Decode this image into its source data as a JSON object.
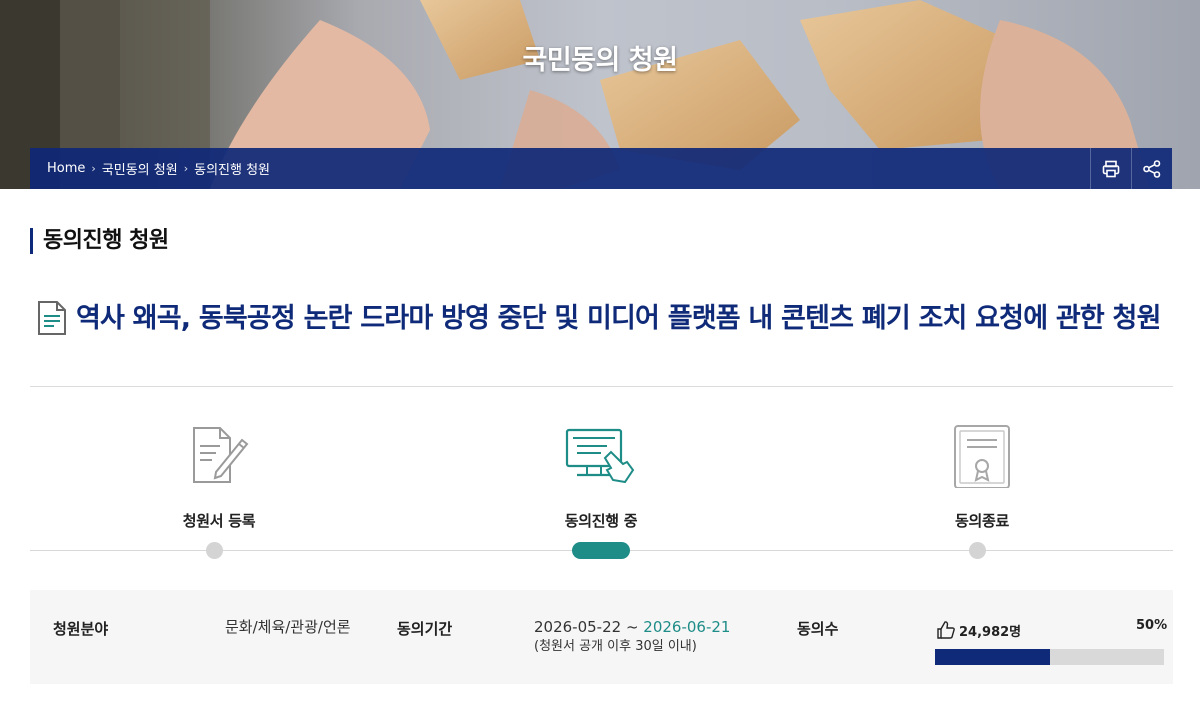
{
  "hero": {
    "title": "국민동의 청원"
  },
  "breadcrumb": {
    "items": [
      "Home",
      "국민동의 청원",
      "동의진행 청원"
    ],
    "tools": [
      {
        "icon": "print-icon"
      },
      {
        "icon": "share-icon"
      }
    ]
  },
  "section": {
    "title": "동의진행 청원"
  },
  "petition": {
    "title": "역사 왜곡, 동북공정 논란 드라마 방영 중단 및 미디어 플랫폼 내 콘텐츠 폐기 조치 요청에 관한 청원"
  },
  "steps": [
    {
      "label": "청원서 등록",
      "icon": "document-write-icon",
      "active": false
    },
    {
      "label": "동의진행 중",
      "icon": "computer-click-icon",
      "active": true
    },
    {
      "label": "동의종료",
      "icon": "certificate-icon",
      "active": false
    }
  ],
  "info": {
    "category_label": "청원분야",
    "category_value": "문화/체육/관광/언론",
    "period_label": "동의기간",
    "period_start": "2026-05-22",
    "period_sep": " ~ ",
    "period_end": "2026-06-21",
    "period_note": "(청원서 공개 이후 30일 이내)",
    "agree_label": "동의수",
    "agree_count": "24,982명",
    "agree_percent_text": "50%",
    "agree_fraction": 0.5
  },
  "colors": {
    "navy": "#0e2a78",
    "teal": "#1e8c87",
    "breadcrumb_bg": "#0f2878"
  }
}
